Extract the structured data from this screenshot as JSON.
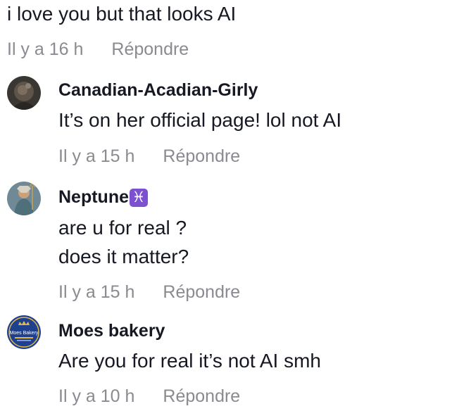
{
  "parent_comment": {
    "text": "i love you but that looks AI",
    "time": "Il y a 16 h",
    "reply_label": "Répondre"
  },
  "replies": [
    {
      "username": "Canadian-Acadian-Girly",
      "lines": [
        "It’s on her official page! lol not AI"
      ],
      "time": "Il y a 15 h",
      "reply_label": "Répondre"
    },
    {
      "username": "Neptune",
      "badge": "♓",
      "lines": [
        "are u for real ?",
        "does it matter?"
      ],
      "time": "Il y a 15 h",
      "reply_label": "Répondre"
    },
    {
      "username": "Moes bakery",
      "lines": [
        "Are you for real it’s not AI smh"
      ],
      "time": "Il y a 10 h",
      "reply_label": "Répondre"
    }
  ],
  "avatar_logo_text": "Moes Bakery",
  "icons": {
    "zodiac_badge": "pisces-icon"
  }
}
